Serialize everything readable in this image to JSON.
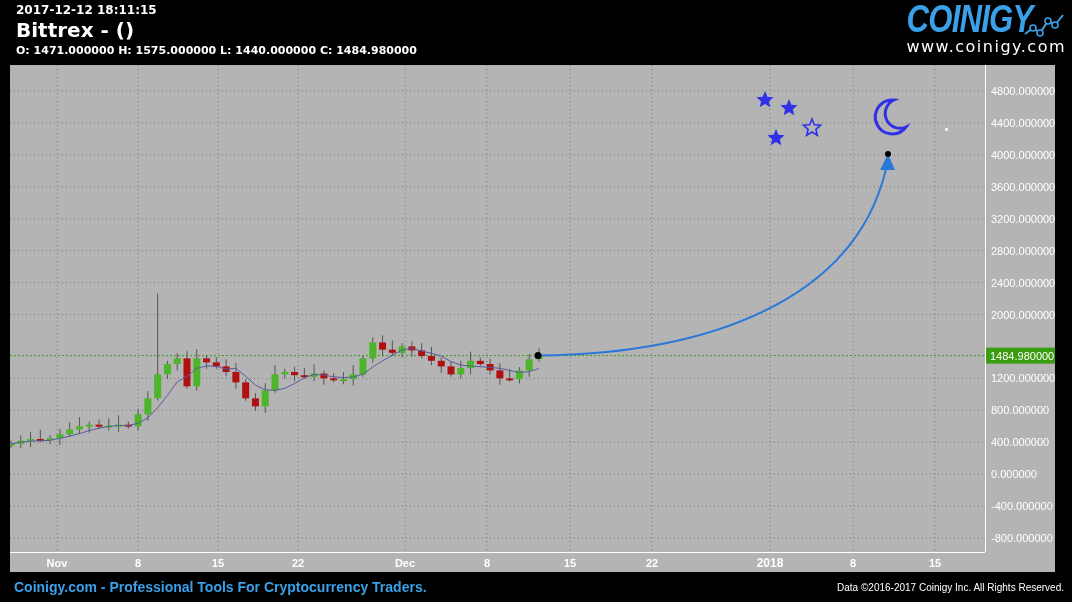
{
  "header": {
    "timestamp": "2017-12-12 18:11:15",
    "title": "Bittrex -  ()",
    "ohlc": "O: 1471.000000 H: 1575.000000 L: 1440.000000 C: 1484.980000"
  },
  "logo": {
    "name": "COINIGY",
    "url": "www.coinigy.com"
  },
  "chart": {
    "price_axis": [
      "4800.000000",
      "4400.000000",
      "4000.000000",
      "3600.000000",
      "3200.000000",
      "2800.000000",
      "2400.000000",
      "2000.000000",
      "1200.000000",
      "800.000000",
      "400.000000",
      "0.000000",
      "-400.000000",
      "-800.000000"
    ],
    "last_price": "1484.980000",
    "time_axis": [
      {
        "label": "Nov",
        "kind": "tick"
      },
      {
        "label": "8",
        "kind": "tick"
      },
      {
        "label": "15",
        "kind": "tick"
      },
      {
        "label": "22",
        "kind": "tick"
      },
      {
        "label": "Dec",
        "kind": "tick"
      },
      {
        "label": "8",
        "kind": "tick"
      },
      {
        "label": "15",
        "kind": "tick"
      },
      {
        "label": "22",
        "kind": "tick"
      },
      {
        "label": "2018",
        "kind": "year"
      },
      {
        "label": "8",
        "kind": "tick"
      },
      {
        "label": "15",
        "kind": "tick"
      }
    ]
  },
  "footer": {
    "tagline": "Coinigy.com - Professional Tools For Cryptocurrency Traders.",
    "copyright": "Data ©2016-2017 Coinigy Inc. All Rights Reserved."
  }
}
